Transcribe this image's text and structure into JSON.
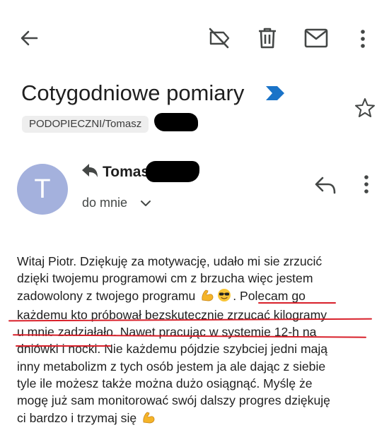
{
  "toolbar": {
    "back_icon": "arrow-back",
    "label_off_icon": "label-off",
    "delete_icon": "trash",
    "mark_unread_icon": "mail",
    "more_icon": "more-vertical"
  },
  "email": {
    "subject": "Cotygodniowe pomiary",
    "label": "PODOPIECZNI/Tomasz",
    "sender_name": "Tomasz",
    "avatar_letter": "T",
    "recipient": "do mnie",
    "body_lines": [
      "Witaj Piotr. Dziękuję za motywację, udało mi sie zrzucić",
      "dzięki twojemu programowi cm z brzucha więc jestem",
      "zadowolony z twojego programu",
      " Polecam go",
      "każdemu kto próbował bezskutecznie zrzucać kilogramy",
      "u mnie zadziałało. Nawet pracując w systemie 12-h na",
      "dniówki i nocki.",
      " Nie każdemu pójdzie szybciej jedni mają",
      "inny metabolizm z tych osób jestem ja ale dając z siebie",
      "tyle ile możesz także można dużo osiągnąć. Myślę że",
      "mogę już sam monitorować swój dalszy progres dziękuję",
      "ci bardzo i trzymaj się"
    ]
  },
  "colors": {
    "avatar_bg": "#a4b1dd",
    "importance_marker": "#1a73c8",
    "underline": "#d8202a",
    "chip_bg": "#eeeeee"
  }
}
